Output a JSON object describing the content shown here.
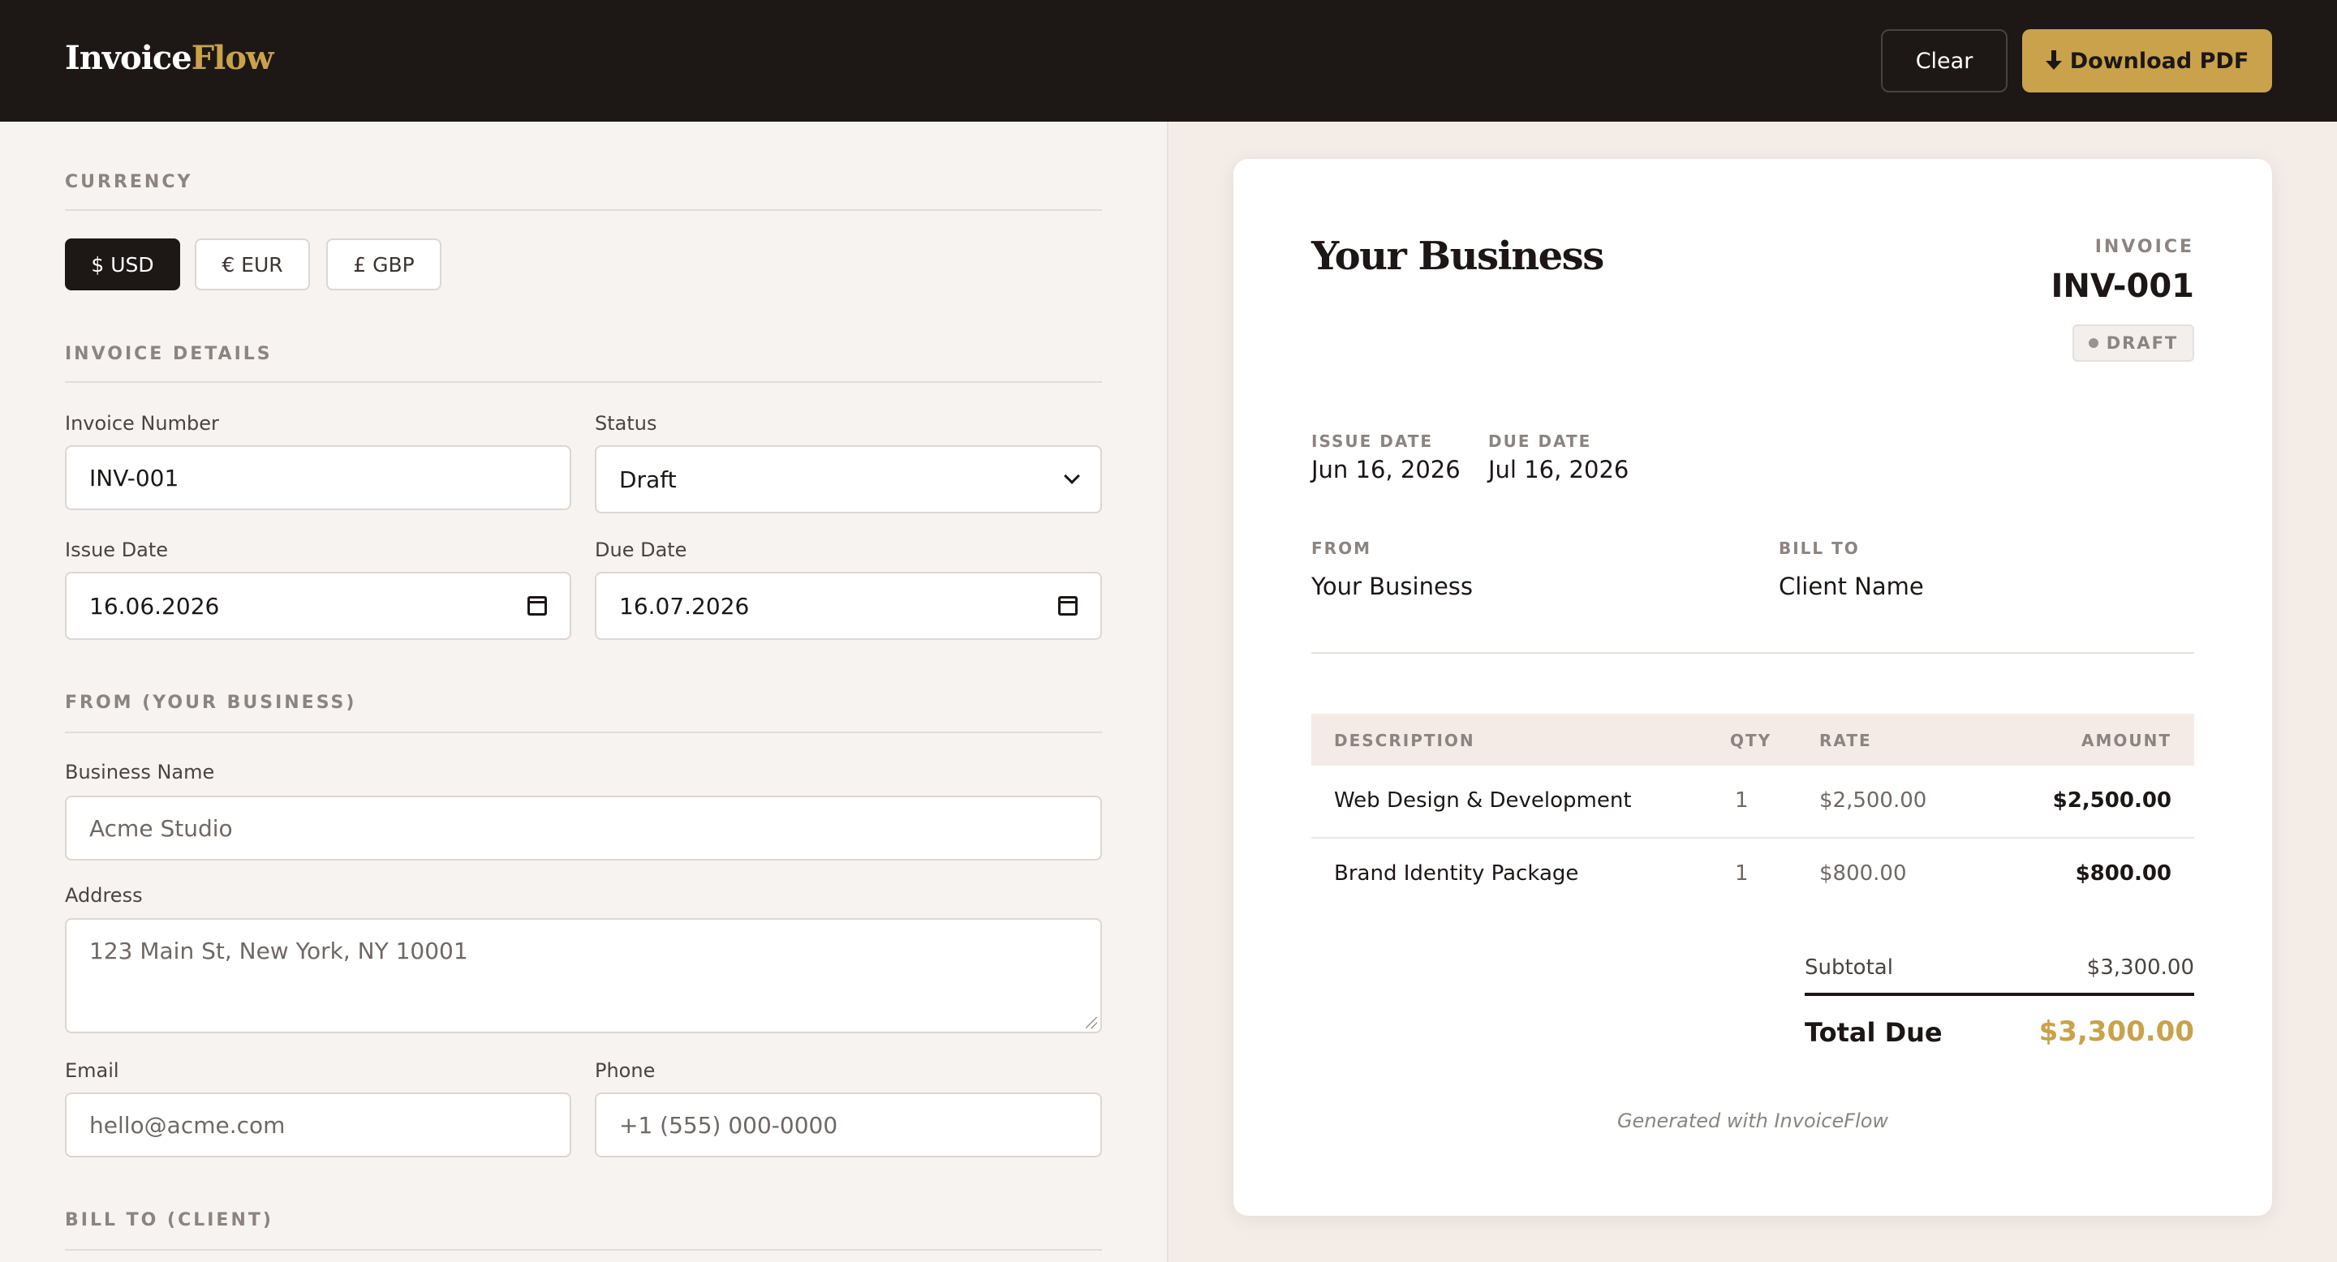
{
  "header": {
    "logo_main": "Invoice",
    "logo_accent": "Flow",
    "clear_label": "Clear",
    "download_label": "Download PDF"
  },
  "form": {
    "currency": {
      "section_title": "CURRENCY",
      "options": [
        "$ USD",
        "€ EUR",
        "£ GBP"
      ],
      "selected": "$ USD"
    },
    "invoice_details": {
      "section_title": "INVOICE DETAILS",
      "invoice_number_label": "Invoice Number",
      "invoice_number_value": "INV-001",
      "status_label": "Status",
      "status_value": "Draft",
      "issue_date_label": "Issue Date",
      "issue_date_value": "16.06.2026",
      "due_date_label": "Due Date",
      "due_date_value": "16.07.2026"
    },
    "from": {
      "section_title": "FROM (YOUR BUSINESS)",
      "business_name_label": "Business Name",
      "business_name_placeholder": "Acme Studio",
      "address_label": "Address",
      "address_placeholder": "123 Main St, New York, NY 10001",
      "email_label": "Email",
      "email_placeholder": "hello@acme.com",
      "phone_label": "Phone",
      "phone_placeholder": "+1 (555) 000-0000"
    },
    "bill_to": {
      "section_title": "BILL TO (CLIENT)"
    }
  },
  "preview": {
    "business_title": "Your Business",
    "invoice_kicker": "INVOICE",
    "invoice_number": "INV-001",
    "status_badge": "DRAFT",
    "issue_date_label": "ISSUE DATE",
    "issue_date": "Jun 16, 2026",
    "due_date_label": "DUE DATE",
    "due_date": "Jul 16, 2026",
    "from_label": "FROM",
    "from_value": "Your Business",
    "bill_to_label": "BILL TO",
    "bill_to_value": "Client Name",
    "table": {
      "headers": [
        "DESCRIPTION",
        "QTY",
        "RATE",
        "AMOUNT"
      ],
      "rows": [
        {
          "description": "Web Design & Development",
          "qty": "1",
          "rate": "$2,500.00",
          "amount": "$2,500.00"
        },
        {
          "description": "Brand Identity Package",
          "qty": "1",
          "rate": "$800.00",
          "amount": "$800.00"
        }
      ]
    },
    "subtotal_label": "Subtotal",
    "subtotal_value": "$3,300.00",
    "total_label": "Total Due",
    "total_value": "$3,300.00",
    "footer_note": "Generated with InvoiceFlow"
  },
  "colors": {
    "brand_accent": "#c9a24b",
    "header_bg": "#1d1716",
    "panel_bg": "#f7f3f1"
  },
  "icons": [
    "download-icon",
    "calendar-icon",
    "chevron-down-icon",
    "status-dot-icon",
    "resize-grip-icon"
  ]
}
